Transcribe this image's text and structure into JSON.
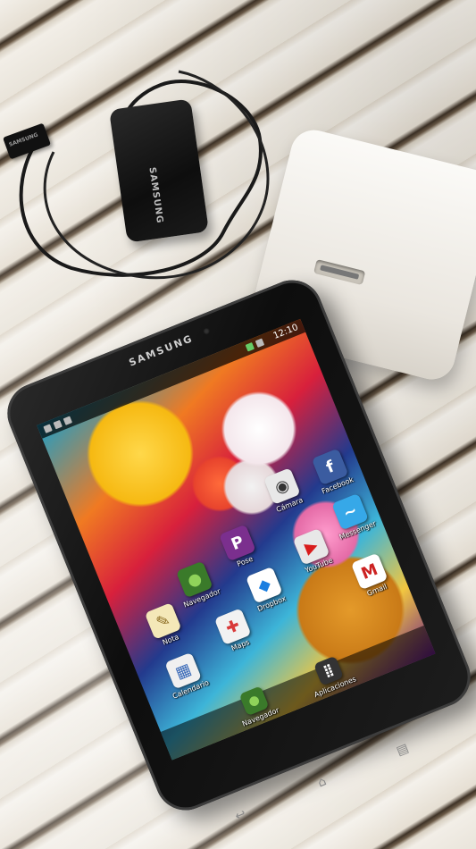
{
  "charger": {
    "brand": "SAMSUNG"
  },
  "connector": {
    "brand": "SAMSUNG"
  },
  "tablet": {
    "brand": "SAMSUNG",
    "status": {
      "time": "12:10"
    },
    "apps": [
      {
        "label": "Facebook",
        "glyph": "f",
        "color": "#3b5ca0",
        "fg": "#ffffff"
      },
      {
        "label": "Cámara",
        "glyph": "◉",
        "color": "#e8e8e8",
        "fg": "#333333"
      },
      {
        "label": "Pose",
        "glyph": "P",
        "color": "#7b2f8e",
        "fg": "#ffffff"
      },
      {
        "label": "Messenger",
        "glyph": "~",
        "color": "#36a8e8",
        "fg": "#ffffff"
      },
      {
        "label": "YouTube",
        "glyph": "▶",
        "color": "#e8e8e8",
        "fg": "#d91c1c"
      },
      {
        "label": "Dropbox",
        "glyph": "◆",
        "color": "#ffffff",
        "fg": "#1a7ee0"
      },
      {
        "label": "Navegador",
        "glyph": "●",
        "color": "#3a7a2a",
        "fg": "#8fd35a"
      },
      {
        "label": "Nota",
        "glyph": "✎",
        "color": "#f4e8b8",
        "fg": "#8a6a20"
      },
      {
        "label": "Maps",
        "glyph": "✚",
        "color": "#f2f2f2",
        "fg": "#d93a3a"
      },
      {
        "label": "Gmail",
        "glyph": "M",
        "color": "#ffffff",
        "fg": "#cc2222"
      },
      {
        "label": "Calendario",
        "glyph": "▦",
        "color": "#f0f0f0",
        "fg": "#3a6ab8"
      }
    ],
    "dock": [
      {
        "label": "Navegador",
        "glyph": "●",
        "color": "#3a7a2a",
        "fg": "#8fd35a"
      },
      {
        "label": "Aplicaciones",
        "glyph": "⣿",
        "color": "#333333",
        "fg": "#ffffff"
      }
    ]
  }
}
